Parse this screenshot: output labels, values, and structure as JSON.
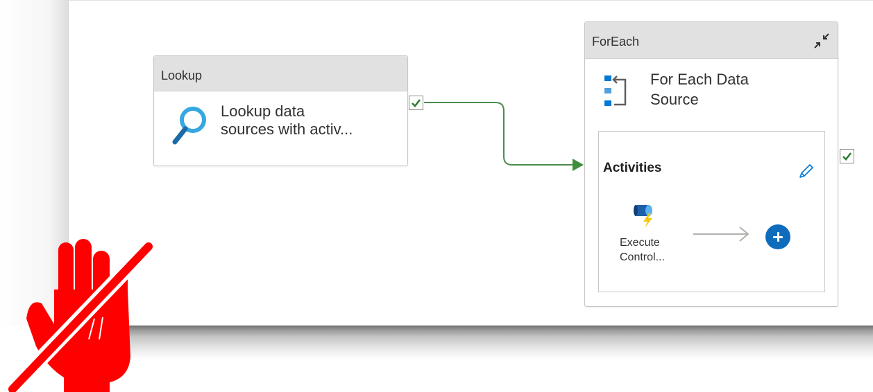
{
  "pipeline": {
    "lookup": {
      "type": "Lookup",
      "description_lines": [
        "Lookup data",
        "sources with activ..."
      ],
      "icon": "lookup-search-icon"
    },
    "foreach": {
      "type": "ForEach",
      "description_lines": [
        "For Each Data",
        "Source"
      ],
      "icon": "foreach-loop-icon",
      "collapse_icon": "collapse-arrows-icon",
      "inner": {
        "title": "Activities",
        "edit_icon": "pencil-icon",
        "activity": {
          "label_lines": [
            "Execute",
            "Control..."
          ],
          "icon": "execute-pipeline-icon"
        },
        "add_icon": "plus-circle-icon"
      }
    },
    "success_icon": "checkmark-icon"
  },
  "overlay": {
    "icon": "stop-hand-forbidden-icon"
  },
  "colors": {
    "connector_green": "#4b8b4b",
    "success_check": "#2f7d32",
    "header_gray": "#e1e1e1",
    "add_button_blue": "#0f6cbd",
    "overlay_red": "#ff0000",
    "lookup_icon_blue": "#36a7e0"
  }
}
